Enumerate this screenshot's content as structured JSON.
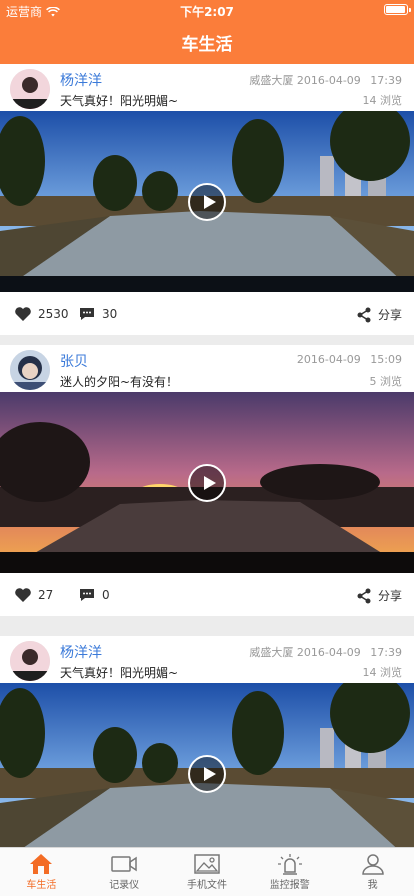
{
  "status": {
    "carrier": "运营商",
    "time": "下午2:07"
  },
  "header": {
    "title": "车生活"
  },
  "posts": [
    {
      "name": "杨洋洋",
      "text": "天气真好！阳光明媚~",
      "location": "威盛大厦",
      "date": "2016-04-09",
      "time": "17:39",
      "views": "14 浏览",
      "likes": "2530",
      "comments": "30",
      "share": "分享",
      "scene": "day"
    },
    {
      "name": "张贝",
      "text": "迷人的夕阳~有没有！",
      "location": "",
      "date": "2016-04-09",
      "time": "15:09",
      "views": "5 浏览",
      "likes": "27",
      "comments": "0",
      "share": "分享",
      "scene": "sunset"
    },
    {
      "name": "杨洋洋",
      "text": "天气真好！阳光明媚~",
      "location": "威盛大厦",
      "date": "2016-04-09",
      "time": "17:39",
      "views": "14 浏览",
      "likes": "",
      "comments": "",
      "share": "",
      "scene": "day"
    }
  ],
  "tabs": [
    {
      "label": "车生活",
      "icon": "home-icon"
    },
    {
      "label": "记录仪",
      "icon": "video-camera-icon"
    },
    {
      "label": "手机文件",
      "icon": "image-icon"
    },
    {
      "label": "监控报警",
      "icon": "alarm-light-icon"
    },
    {
      "label": "我",
      "icon": "user-icon"
    }
  ],
  "colors": {
    "accent": "#fb7d3a",
    "name": "#3b7ad9",
    "active_tab": "#f36c25"
  }
}
